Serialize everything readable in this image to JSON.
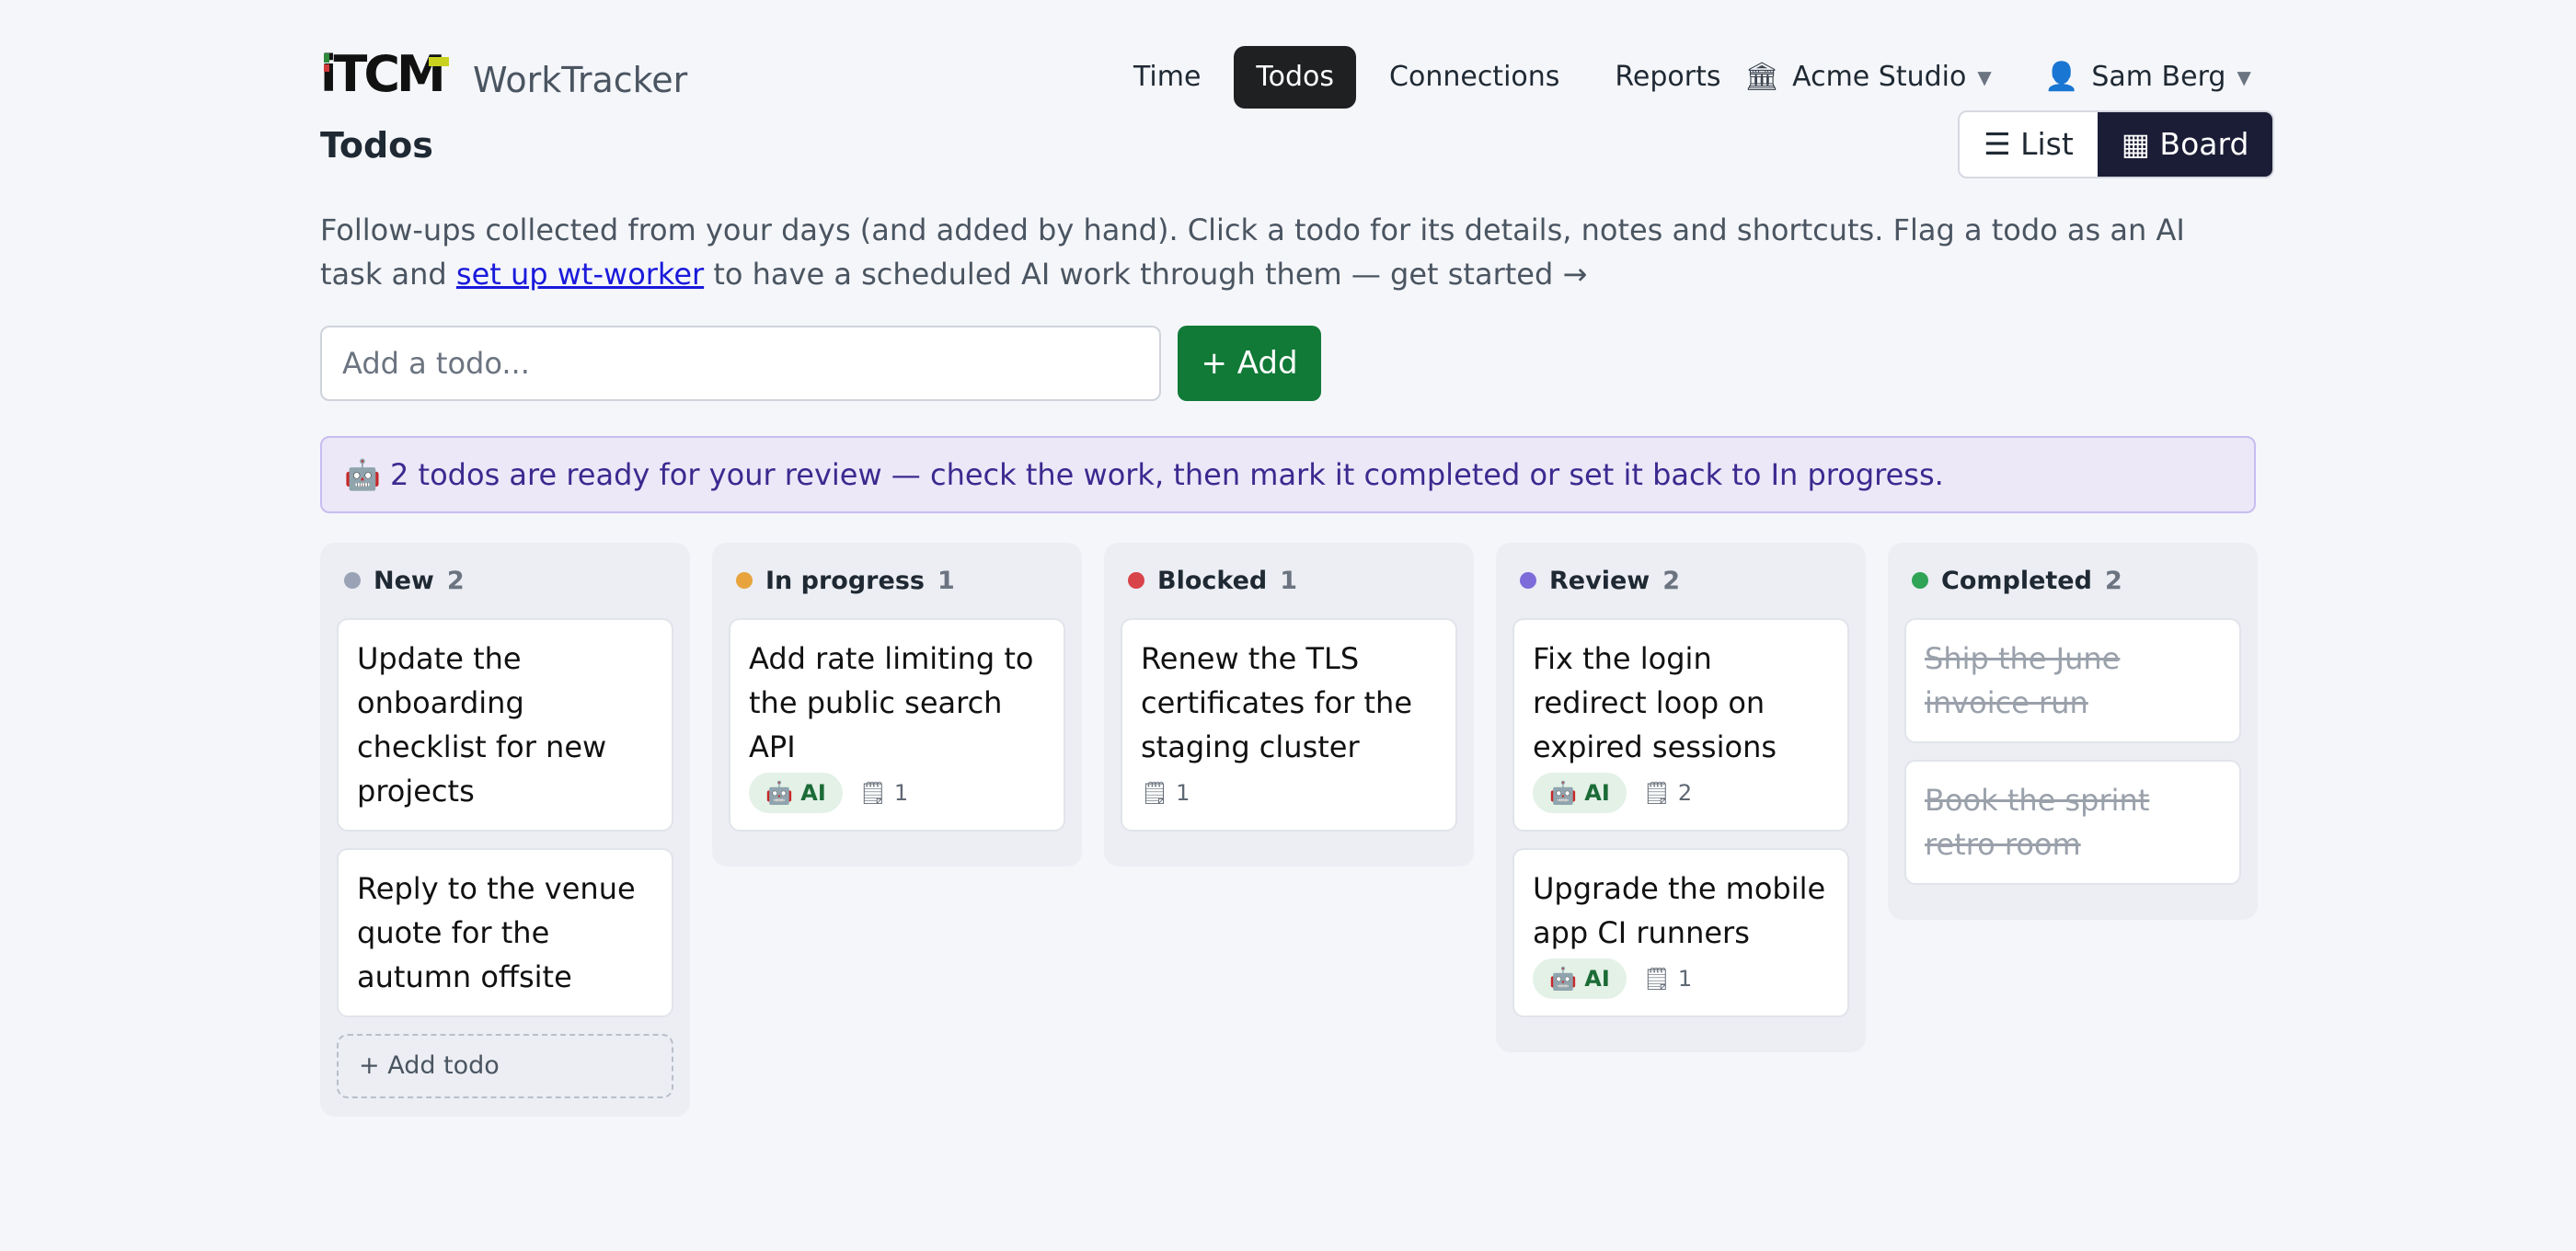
{
  "header": {
    "logo_text": "iTCM",
    "app_name": "WorkTracker",
    "nav": [
      {
        "label": "Time"
      },
      {
        "label": "Todos",
        "active": true
      },
      {
        "label": "Connections"
      },
      {
        "label": "Reports"
      }
    ],
    "org": "Acme Studio",
    "user": "Sam Berg"
  },
  "page": {
    "title": "Todos",
    "view_toggle": {
      "list": "☰ List",
      "board": "▦ Board",
      "active": "board"
    },
    "intro_before": "Follow-ups collected from your days (and added by hand). Click a todo for its details, notes and shortcuts. Flag a todo as an AI task and ",
    "intro_link": "set up wt-worker",
    "intro_after": " to have a scheduled AI work through them — get started →",
    "add_placeholder": "Add a todo...",
    "add_button": "+ Add",
    "banner": "🤖 2 todos are ready for your review — check the work, then mark it completed or set it back to In progress."
  },
  "board": {
    "ai_label": "🤖 AI",
    "add_todo_label": "+ Add todo",
    "columns": [
      {
        "name": "New",
        "count": "2",
        "color": "#9aa3b5",
        "cards": [
          {
            "title": "Update the onboarding checklist for new projects"
          },
          {
            "title": "Reply to the venue quote for the autumn offsite"
          }
        ]
      },
      {
        "name": "In progress",
        "count": "1",
        "color": "#e8a33d",
        "cards": [
          {
            "title": "Add rate limiting to the public search API",
            "ai": true,
            "notes": "🗒 1"
          }
        ]
      },
      {
        "name": "Blocked",
        "count": "1",
        "color": "#d9434a",
        "cards": [
          {
            "title": "Renew the TLS certificates for the staging cluster",
            "notes": "🗒 1"
          }
        ]
      },
      {
        "name": "Review",
        "count": "2",
        "color": "#7c6bd9",
        "cards": [
          {
            "title": "Fix the login redirect loop on expired sessions",
            "ai": true,
            "notes": "🗒 2"
          },
          {
            "title": "Upgrade the mobile app CI runners",
            "ai": true,
            "notes": "🗒 1"
          }
        ]
      },
      {
        "name": "Completed",
        "count": "2",
        "color": "#2fa457",
        "cards": [
          {
            "title": "Ship the June invoice run",
            "done": true
          },
          {
            "title": "Book the sprint retro room",
            "done": true
          }
        ]
      }
    ]
  }
}
